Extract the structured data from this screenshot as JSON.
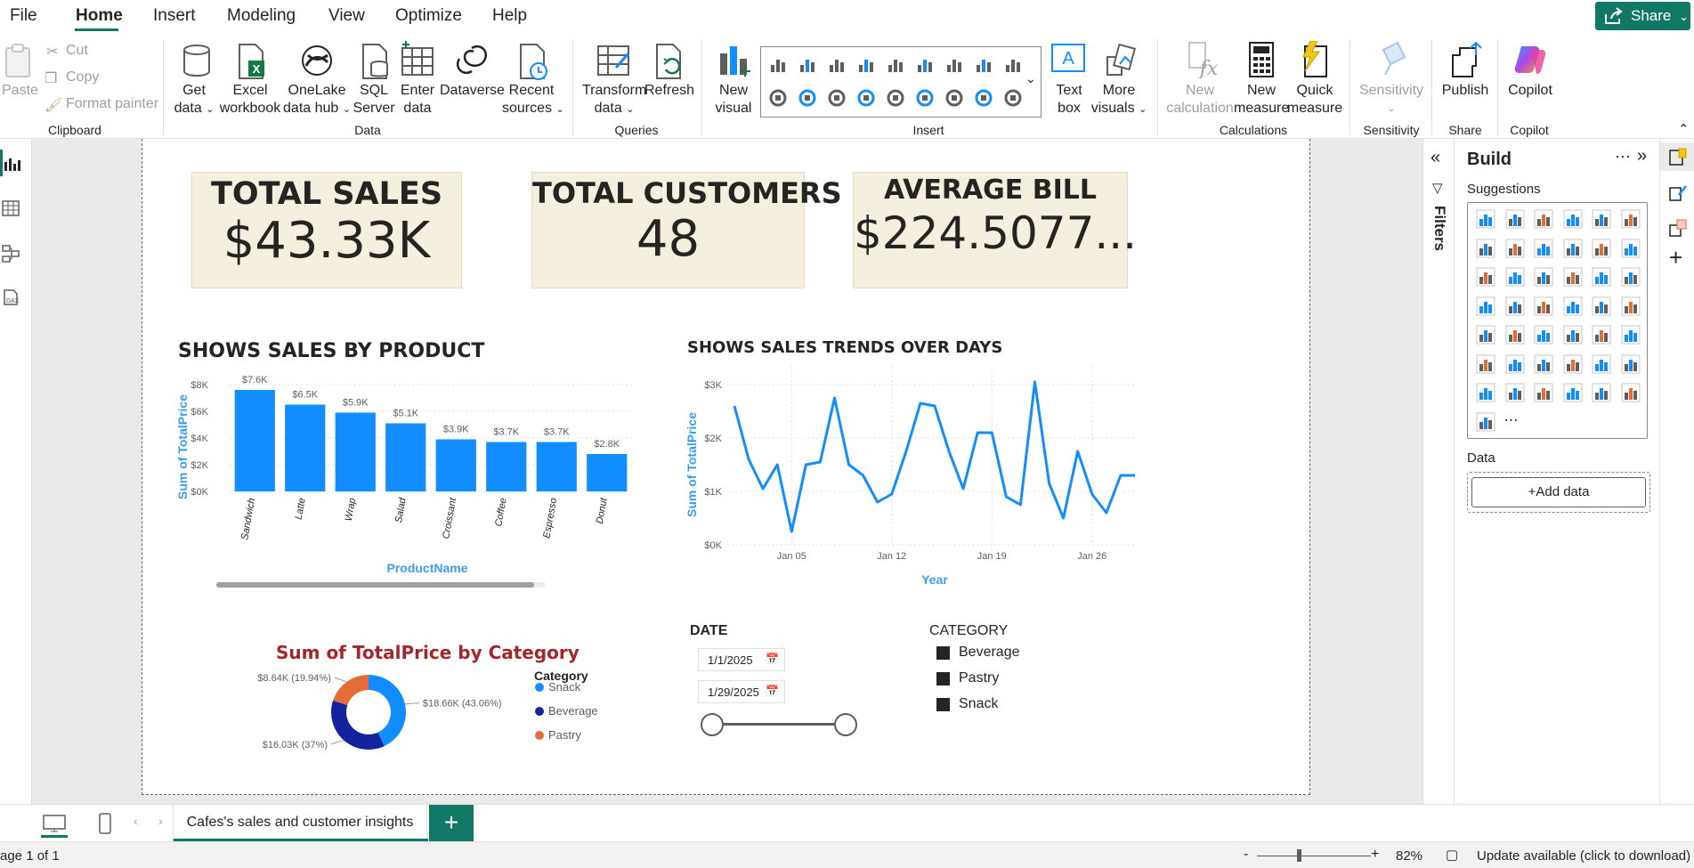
{
  "menu": {
    "file": "File",
    "home": "Home",
    "insert": "Insert",
    "modeling": "Modeling",
    "view": "View",
    "optimize": "Optimize",
    "help": "Help",
    "share": "Share"
  },
  "ribbon": {
    "clipboard": {
      "paste": "Paste",
      "cut": "Cut",
      "copy": "Copy",
      "format_painter": "Format painter",
      "group": "Clipboard"
    },
    "data": {
      "get_data": [
        "Get",
        "data"
      ],
      "excel": [
        "Excel",
        "workbook"
      ],
      "onelake": [
        "OneLake",
        "data hub"
      ],
      "sql": [
        "SQL",
        "Server"
      ],
      "enter": [
        "Enter",
        "data"
      ],
      "dataverse": "Dataverse",
      "recent": [
        "Recent",
        "sources"
      ],
      "group": "Data"
    },
    "queries": {
      "transform": [
        "Transform",
        "data"
      ],
      "refresh": "Refresh",
      "group": "Queries"
    },
    "insert": {
      "new_visual": [
        "New",
        "visual"
      ],
      "text_box": [
        "Text",
        "box"
      ],
      "more_visuals": [
        "More",
        "visuals"
      ],
      "group": "Insert"
    },
    "calculations": {
      "new_calc": [
        "New",
        "calculation"
      ],
      "new_measure": [
        "New",
        "measure"
      ],
      "quick_measure": [
        "Quick",
        "measure"
      ],
      "group": "Calculations"
    },
    "sensitivity": {
      "label": "Sensitivity",
      "group": "Sensitivity"
    },
    "share": {
      "publish": "Publish",
      "group": "Share"
    },
    "copilot": {
      "label": "Copilot",
      "group": "Copilot"
    }
  },
  "cards": [
    {
      "title": "TOTAL SALES",
      "value": "$43.33K"
    },
    {
      "title": "TOTAL CUSTOMERS",
      "value": "48"
    },
    {
      "title": "AVERAGE BILL",
      "value": "$224.5077..."
    }
  ],
  "chart_data": [
    {
      "type": "bar",
      "title": "SHOWS SALES BY PRODUCT",
      "xlabel": "ProductName",
      "ylabel": "Sum of TotalPrice",
      "categories": [
        "Sandwich",
        "Latte",
        "Wrap",
        "Salad",
        "Croissant",
        "Coffee",
        "Espresso",
        "Donut"
      ],
      "values": [
        7600,
        6500,
        5900,
        5100,
        3900,
        3700,
        3700,
        2800
      ],
      "data_labels": [
        "$7.6K",
        "$6.5K",
        "$5.9K",
        "$5.1K",
        "$3.9K",
        "$3.7K",
        "$3.7K",
        "$2.8K"
      ],
      "yticks": [
        "$0K",
        "$2K",
        "$4K",
        "$6K",
        "$8K"
      ],
      "ylim": [
        0,
        8000
      ],
      "color": "#118DFF"
    },
    {
      "type": "line",
      "title": "SHOWS SALES TRENDS OVER DAYS",
      "xlabel": "Year",
      "ylabel": "Sum of TotalPrice",
      "x": [
        "2025-01-01",
        "2025-01-02",
        "2025-01-03",
        "2025-01-04",
        "2025-01-05",
        "2025-01-06",
        "2025-01-07",
        "2025-01-08",
        "2025-01-09",
        "2025-01-10",
        "2025-01-11",
        "2025-01-12",
        "2025-01-13",
        "2025-01-14",
        "2025-01-15",
        "2025-01-16",
        "2025-01-17",
        "2025-01-18",
        "2025-01-19",
        "2025-01-20",
        "2025-01-21",
        "2025-01-22",
        "2025-01-23",
        "2025-01-24",
        "2025-01-25",
        "2025-01-26",
        "2025-01-27",
        "2025-01-28",
        "2025-01-29"
      ],
      "values": [
        2600,
        1600,
        1050,
        1500,
        250,
        1500,
        1550,
        2750,
        1500,
        1300,
        800,
        950,
        1750,
        2650,
        2600,
        1750,
        1050,
        2100,
        2100,
        900,
        750,
        3050,
        1150,
        500,
        1750,
        950,
        600,
        1300,
        1300
      ],
      "xticks": [
        "Jan 05",
        "Jan 12",
        "Jan 19",
        "Jan 26"
      ],
      "yticks": [
        "$0K",
        "$1K",
        "$2K",
        "$3K"
      ],
      "ylim": [
        0,
        3000
      ],
      "color": "#118DFF"
    },
    {
      "type": "pie",
      "title": "Sum of TotalPrice by Category",
      "legend_title": "Category",
      "slices": [
        {
          "name": "Snack",
          "value": 18660,
          "label": "$18.66K (43.06%)",
          "color": "#118DFF"
        },
        {
          "name": "Beverage",
          "value": 16030,
          "label": "$16.03K (37%)",
          "color": "#12239E"
        },
        {
          "name": "Pastry",
          "value": 8640,
          "label": "$8.64K (19.94%)",
          "color": "#E66C37"
        }
      ]
    }
  ],
  "date_slicer": {
    "title": "DATE",
    "start": "1/1/2025",
    "end": "1/29/2025"
  },
  "category_slicer": {
    "title": "CATEGORY",
    "items": [
      "Beverage",
      "Pastry",
      "Snack"
    ]
  },
  "filters_label": "Filters",
  "build": {
    "title": "Build",
    "suggestions": "Suggestions",
    "data": "Data",
    "add_data": "+Add data"
  },
  "tabs": {
    "page": "Cafes's sales and customer insights"
  },
  "status": {
    "page": "age 1 of 1",
    "zoom": "82%",
    "update": "Update available (click to download)"
  }
}
